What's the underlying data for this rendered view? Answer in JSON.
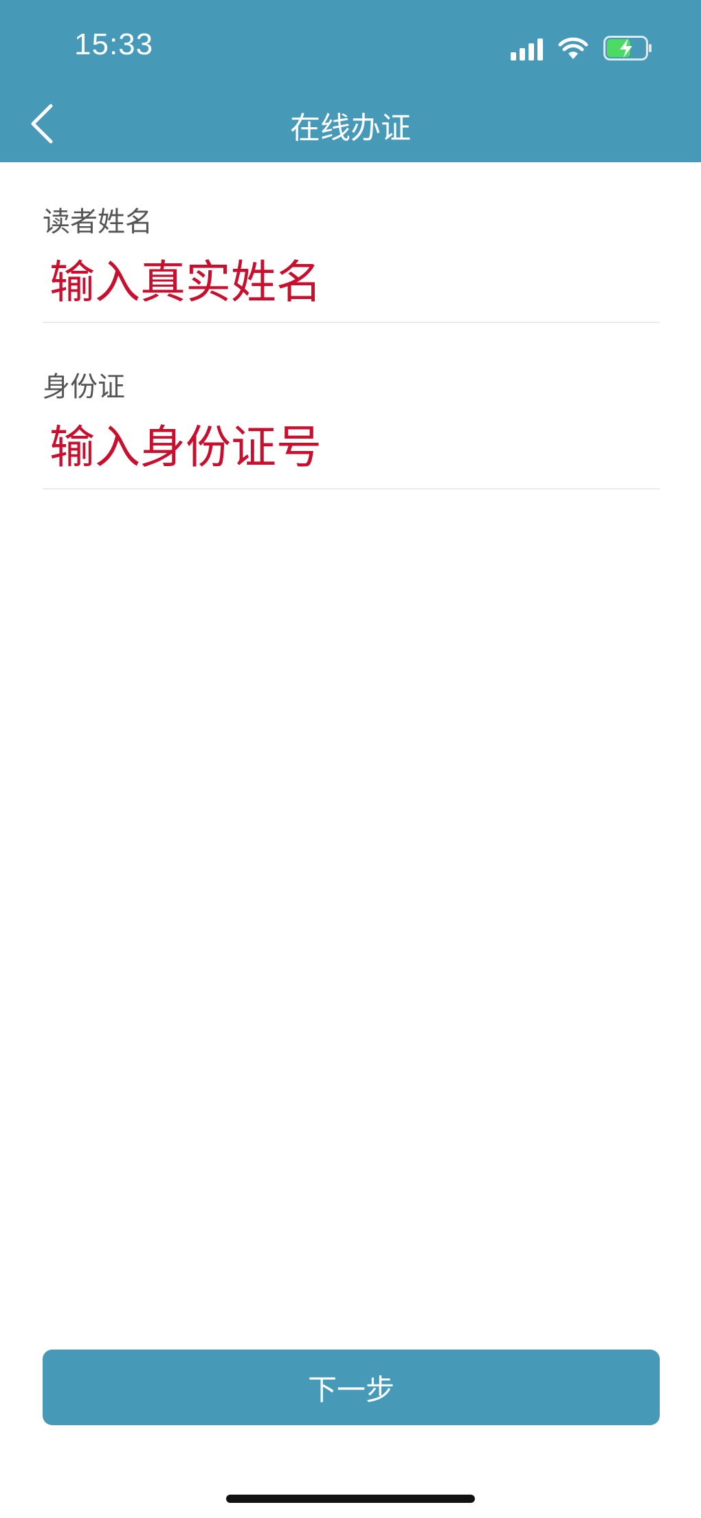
{
  "status_bar": {
    "time": "15:33",
    "icons": [
      "signal-icon",
      "wifi-icon",
      "battery-charging-icon"
    ]
  },
  "nav": {
    "back_icon": "chevron-left-icon",
    "title": "在线办证"
  },
  "form": {
    "reader_name": {
      "label": "读者姓名",
      "placeholder": "输入真实姓名",
      "value": ""
    },
    "id_card": {
      "label": "身份证",
      "placeholder": "输入身份证号",
      "value": ""
    }
  },
  "footer": {
    "next_label": "下一步"
  },
  "colors": {
    "primary": "#4799b8",
    "placeholder": "#c8102e",
    "label": "#555555",
    "divider": "#ebebeb",
    "battery_fill": "#4cd964"
  }
}
